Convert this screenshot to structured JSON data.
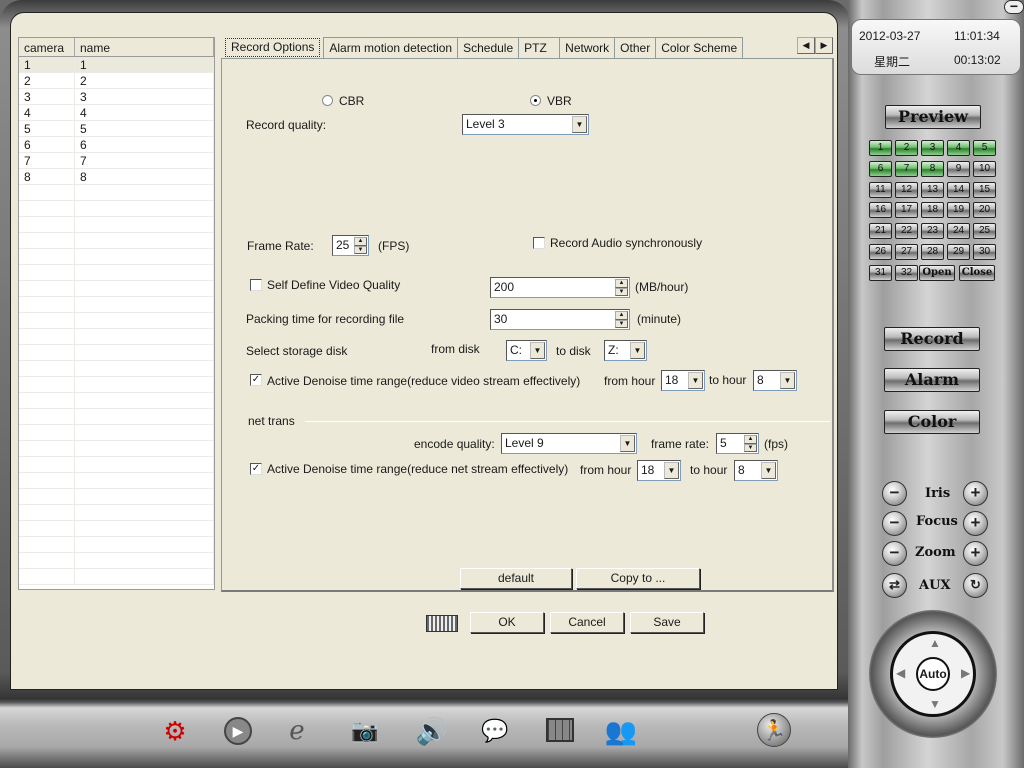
{
  "camera_list": {
    "columns": [
      "camera",
      "name"
    ],
    "rows": [
      {
        "camera": "1",
        "name": "1"
      },
      {
        "camera": "2",
        "name": "2"
      },
      {
        "camera": "3",
        "name": "3"
      },
      {
        "camera": "4",
        "name": "4"
      },
      {
        "camera": "5",
        "name": "5"
      },
      {
        "camera": "6",
        "name": "6"
      },
      {
        "camera": "7",
        "name": "7"
      },
      {
        "camera": "8",
        "name": "8"
      }
    ],
    "selected_row": 0
  },
  "tabs": [
    "Record Options",
    "Alarm motion detection",
    "Schedule",
    "PTZ",
    "Network",
    "Other",
    "Color Scheme"
  ],
  "active_tab": "Record Options",
  "record": {
    "cbr_label": "CBR",
    "vbr_label": "VBR",
    "bitrate_mode": "VBR",
    "quality_label": "Record quality:",
    "quality_value": "Level 3",
    "frame_rate_label": "Frame Rate:",
    "frame_rate_value": "25",
    "frame_rate_unit": "(FPS)",
    "audio_label": "Record Audio synchronously",
    "audio_checked": false,
    "self_define_label": "Self Define Video Quality",
    "self_define_checked": false,
    "self_define_value": "200",
    "self_define_unit": "(MB/hour)",
    "packing_label": "Packing time for recording file",
    "packing_value": "30",
    "packing_unit": "(minute)",
    "storage_label": "Select storage disk",
    "from_disk_label": "from disk",
    "from_disk_value": "C:",
    "to_disk_label": "to disk",
    "to_disk_value": "Z:",
    "denoise_label": "Active Denoise time range(reduce video stream effectively)",
    "denoise_checked": true,
    "from_hour_label": "from hour",
    "from_hour_value": "18",
    "to_hour_label": "to hour",
    "to_hour_value": "8"
  },
  "net_trans": {
    "section_label": "net trans",
    "encode_quality_label": "encode quality:",
    "encode_quality_value": "Level 9",
    "frame_rate_label": "frame rate:",
    "frame_rate_value": "5",
    "frame_rate_unit": "(fps)",
    "denoise_label": "Active Denoise time range(reduce net stream effectively)",
    "denoise_checked": true,
    "from_hour_label": "from hour",
    "from_hour_value": "18",
    "to_hour_label": "to hour",
    "to_hour_value": "8"
  },
  "panel_buttons": {
    "default": "default",
    "copy_to": "Copy to ..."
  },
  "dialog_buttons": {
    "ok": "OK",
    "cancel": "Cancel",
    "save": "Save"
  },
  "clock": {
    "date": "2012-03-27",
    "time": "11:01:34",
    "weekday": "星期二",
    "elapsed": "00:13:02"
  },
  "side_panel": {
    "preview": "Preview",
    "channels": [
      "1",
      "2",
      "3",
      "4",
      "5",
      "6",
      "7",
      "8",
      "9",
      "10",
      "11",
      "12",
      "13",
      "14",
      "15",
      "16",
      "17",
      "18",
      "19",
      "20",
      "21",
      "22",
      "23",
      "24",
      "25",
      "26",
      "27",
      "28",
      "29",
      "30",
      "31",
      "32"
    ],
    "active_channels": 8,
    "open": "Open",
    "close": "Close",
    "record": "Record",
    "alarm": "Alarm",
    "color": "Color",
    "ptz": {
      "iris": "Iris",
      "focus": "Focus",
      "zoom": "Zoom",
      "aux": "AUX",
      "auto": "Auto"
    }
  },
  "toolbar_icons": [
    "settings-gear-icon",
    "play-icon",
    "browser-icon",
    "camera-icon",
    "speaker-icon",
    "chat-icon",
    "grid-display-icon",
    "users-icon"
  ],
  "colors": {
    "dialog_bg": "#ece9d8",
    "channel_active": "#4f9f4f",
    "accent_red": "#cc0000"
  }
}
